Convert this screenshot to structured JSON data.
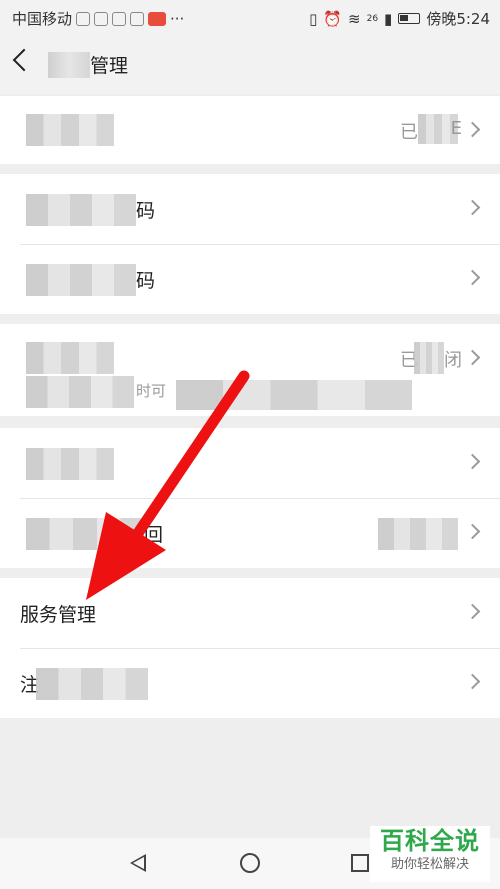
{
  "status": {
    "carrier": "中国移动",
    "dots": "···",
    "time": "傍晚5:24",
    "network_badge": "26"
  },
  "header": {
    "title": "管理"
  },
  "rows": {
    "r1": {
      "value_left": "已",
      "value_right": "E"
    },
    "r2": {
      "label_tail": "码"
    },
    "r3": {
      "label_tail": "码"
    },
    "r4": {
      "value_left": "已",
      "value_right": "闭",
      "sub": "时可"
    },
    "r6": {
      "label_tail": "回"
    },
    "service": {
      "label": "服务管理"
    },
    "r8": {
      "label_head": "注"
    }
  },
  "watermark": {
    "title": "百科全说",
    "subtitle": "助你轻松解决"
  },
  "colors": {
    "arrow": "#ee1111",
    "brand_green": "#2ea84a"
  }
}
